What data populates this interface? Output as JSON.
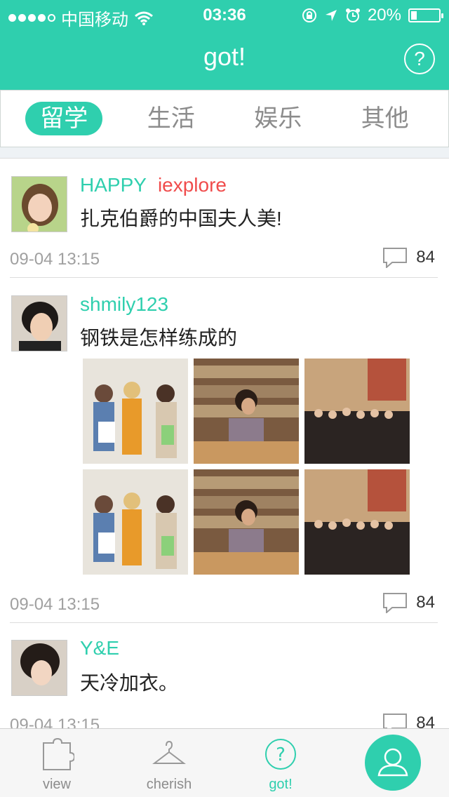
{
  "status": {
    "carrier": "中国移动",
    "time": "03:36",
    "battery": "20%",
    "battery_level": 0.2
  },
  "header": {
    "title": "got!",
    "help_label": "?"
  },
  "tabs": [
    {
      "label": "留学",
      "active": true
    },
    {
      "label": "生活",
      "active": false
    },
    {
      "label": "娱乐",
      "active": false
    },
    {
      "label": "其他",
      "active": false
    }
  ],
  "posts": [
    {
      "user": "HAPPY",
      "tag": "iexplore",
      "text": "扎克伯爵的中国夫人美!",
      "time": "09-04 13:15",
      "comments": "84"
    },
    {
      "user": "shmily123",
      "tag": "",
      "text": "钢铁是怎样练成的",
      "time": "09-04 13:15",
      "comments": "84"
    },
    {
      "user": "Y&E",
      "tag": "",
      "text": "天冷加衣。",
      "time": "09-04 13:15",
      "comments": "84"
    }
  ],
  "tabbar": {
    "view": "view",
    "cherish": "cherish",
    "got": "got!"
  },
  "colors": {
    "accent": "#2fcfae",
    "tag": "#f04c4c"
  }
}
